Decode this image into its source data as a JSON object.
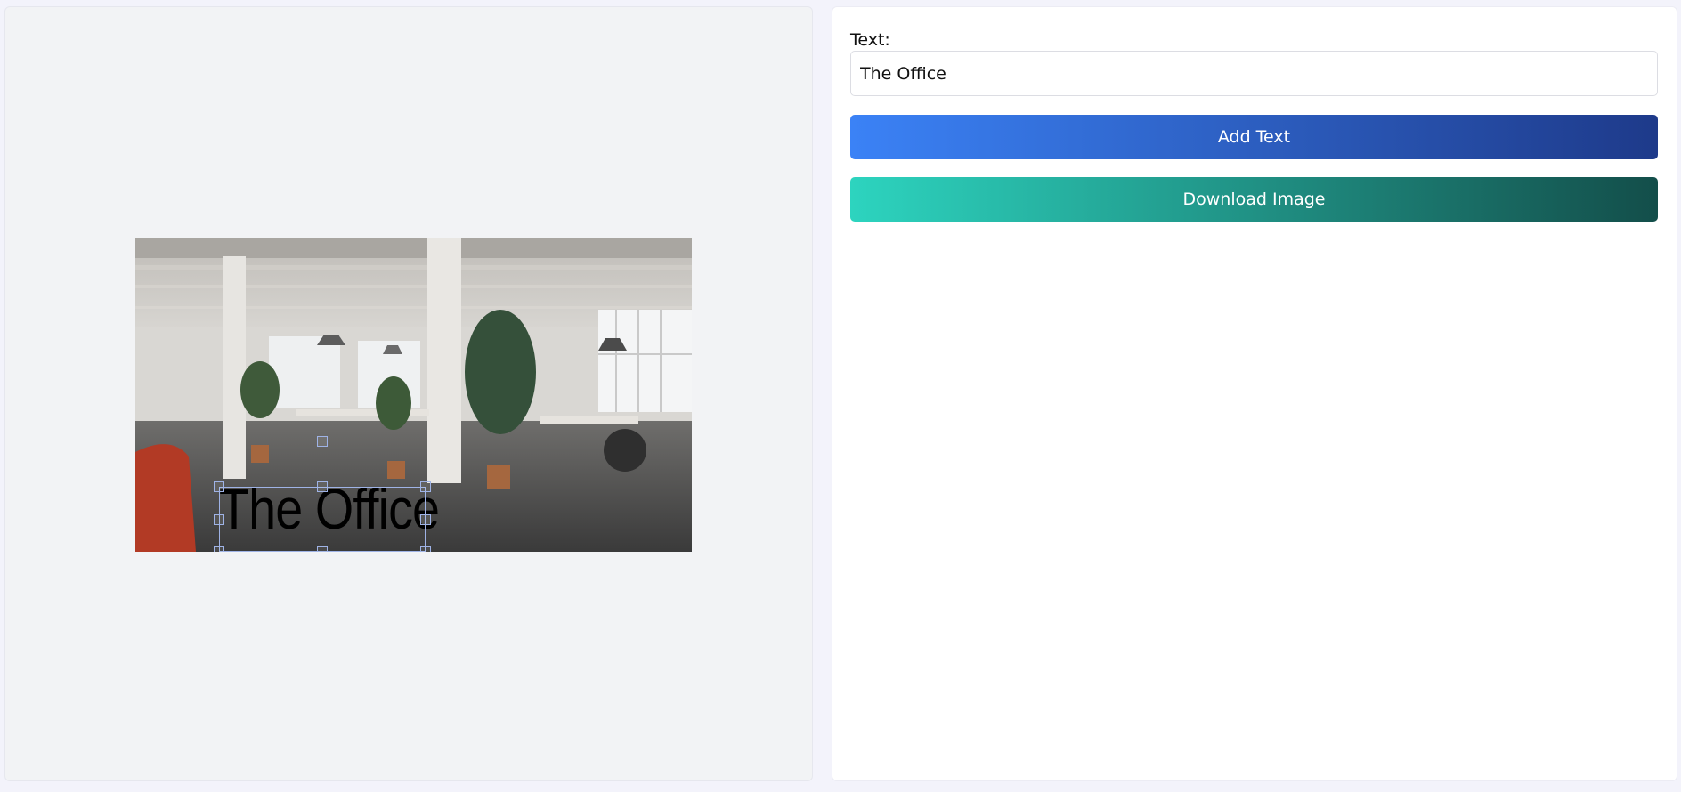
{
  "canvas": {
    "overlay_text": "The Office",
    "image_description_icon": "office-photo"
  },
  "controls": {
    "text_label": "Text:",
    "text_value": "The Office",
    "add_text_label": "Add Text",
    "download_label": "Download Image"
  },
  "colors": {
    "add_button_gradient": [
      "#3b82f6",
      "#1e3a8a"
    ],
    "download_button_gradient": [
      "#2dd4bf",
      "#134e4a"
    ],
    "selection_border": "#9fb3e6"
  }
}
